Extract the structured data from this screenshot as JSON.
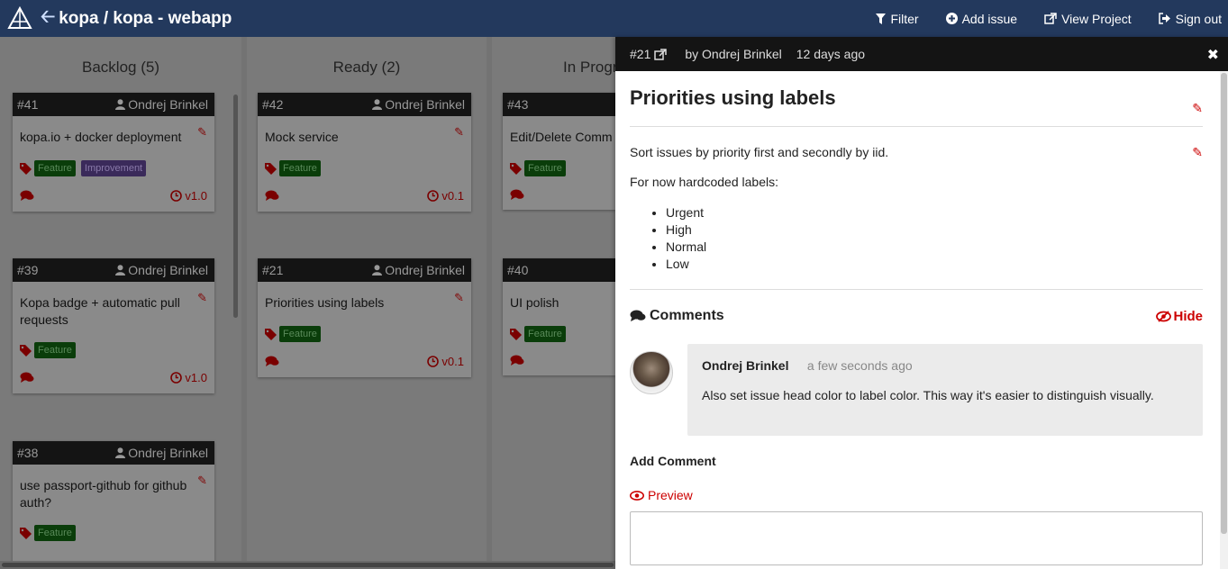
{
  "navbar": {
    "repo_title": "kopa / kopa - webapp",
    "filter_label": "Filter",
    "add_issue_label": "Add issue",
    "view_project_label": "View Project",
    "sign_out_label": "Sign out"
  },
  "board": {
    "columns": [
      {
        "title": "Backlog (5)"
      },
      {
        "title": "Ready (2)"
      },
      {
        "title": "In Progr"
      }
    ],
    "cards": [
      {
        "num": "#41",
        "author": "Ondrej Brinkel",
        "title": "kopa.io + docker deployment",
        "labels": [
          "Feature",
          "Improvement"
        ],
        "milestone": "v1.0"
      },
      {
        "num": "#39",
        "author": "Ondrej Brinkel",
        "title": "Kopa badge + automatic pull requests",
        "labels": [
          "Feature"
        ],
        "milestone": "v1.0"
      },
      {
        "num": "#38",
        "author": "Ondrej Brinkel",
        "title": "use passport-github for github auth?",
        "labels": [
          "Feature"
        ],
        "milestone": ""
      },
      {
        "num": "#42",
        "author": "Ondrej Brinkel",
        "title": "Mock service",
        "labels": [
          "Feature"
        ],
        "milestone": "v0.1"
      },
      {
        "num": "#21",
        "author": "Ondrej Brinkel",
        "title": "Priorities using labels",
        "labels": [
          "Feature"
        ],
        "milestone": "v0.1"
      },
      {
        "num": "#43",
        "author": "",
        "title": "Edit/Delete Comm",
        "labels": [
          "Feature"
        ],
        "milestone": ""
      },
      {
        "num": "#40",
        "author": "",
        "title": "UI polish",
        "labels": [
          "Feature"
        ],
        "milestone": ""
      }
    ]
  },
  "panel": {
    "issue_number": "#21",
    "by": "by Ondrej Brinkel",
    "created_ago": "12 days ago",
    "title": "Priorities using labels",
    "description_line1": "Sort issues by priority first and secondly by iid.",
    "description_line2": "For now hardcoded labels:",
    "priorities": [
      "Urgent",
      "High",
      "Normal",
      "Low"
    ],
    "comments_title": "Comments",
    "hide_label": "Hide",
    "comment": {
      "author": "Ondrej Brinkel",
      "time": "a few seconds ago",
      "text": "Also set issue head color to label color. This way it's easier to distinguish visually."
    },
    "add_comment_label": "Add Comment",
    "preview_label": "Preview",
    "comment_input_value": ""
  },
  "colors": {
    "navbar_bg": "#23395d",
    "accent_red": "#cc0000",
    "card_head_bg": "#141414",
    "feature_label_bg": "#0a3d0a",
    "improvement_label_bg": "#3a2a5a"
  }
}
